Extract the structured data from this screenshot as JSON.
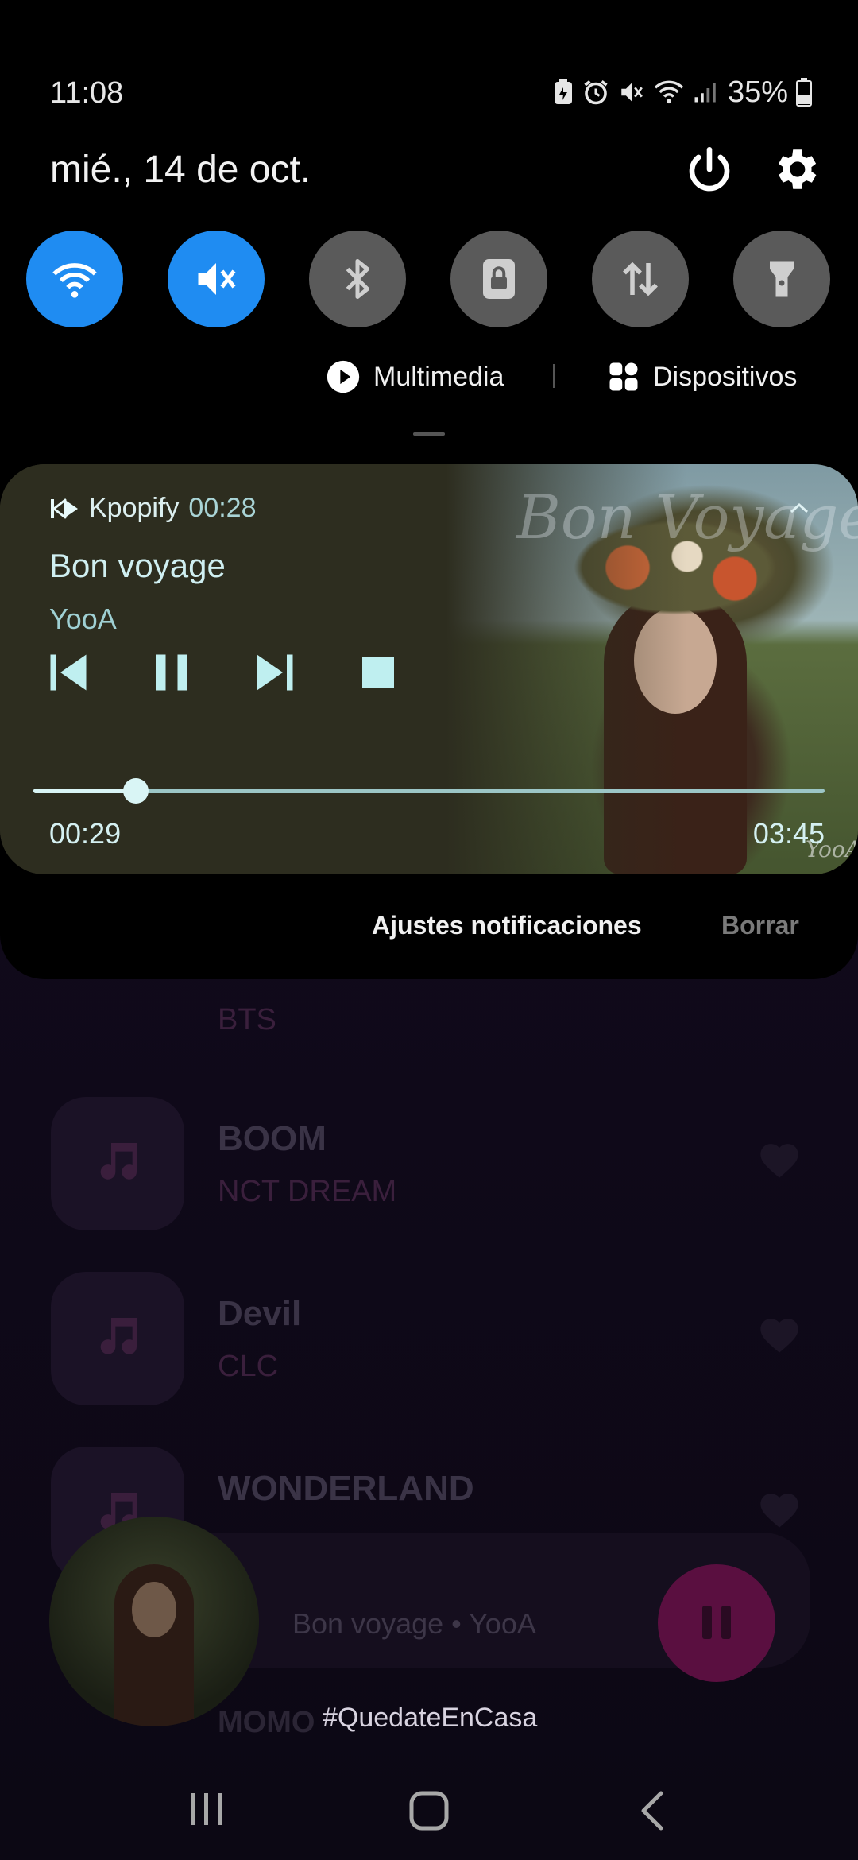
{
  "status_bar": {
    "time": "11:08",
    "battery_percent": "35%",
    "icons": [
      "battery-saver-icon",
      "alarm-icon",
      "mute-icon",
      "wifi-icon",
      "signal-icon",
      "battery-icon"
    ]
  },
  "shade": {
    "date": "mié., 14 de oct.",
    "quick_settings": [
      {
        "name": "wifi",
        "active": true
      },
      {
        "name": "mute",
        "active": true
      },
      {
        "name": "bluetooth",
        "active": false
      },
      {
        "name": "rotation-lock",
        "active": false
      },
      {
        "name": "mobile-data",
        "active": false
      },
      {
        "name": "flashlight",
        "active": false
      }
    ],
    "chips": {
      "media": "Multimedia",
      "devices": "Dispositivos"
    }
  },
  "media": {
    "app_name": "Kpopify",
    "elapsed_label": "00:28",
    "title": "Bon voyage",
    "artist": "YooA",
    "art_title": "Bon Voyage",
    "art_signature": "YooA",
    "position": "00:29",
    "duration": "03:45",
    "progress_fraction": 0.13
  },
  "notification_actions": {
    "settings": "Ajustes notificaciones",
    "clear": "Borrar"
  },
  "background_app": {
    "songs": [
      {
        "title": "",
        "artist": "BTS"
      },
      {
        "title": "BOOM",
        "artist": "NCT DREAM"
      },
      {
        "title": "Devil",
        "artist": "CLC"
      },
      {
        "title": "WONDERLAND",
        "artist": ""
      }
    ],
    "partial_song": "MOMO",
    "mini_player_label": "Bon voyage • YooA",
    "hashtag": "#QuedateEnCasa"
  },
  "colors": {
    "qs_active": "#1f8cf2",
    "qs_inactive": "#5a5a5a",
    "media_bg": "#2d2d1f",
    "media_text": "#cfeff1"
  }
}
